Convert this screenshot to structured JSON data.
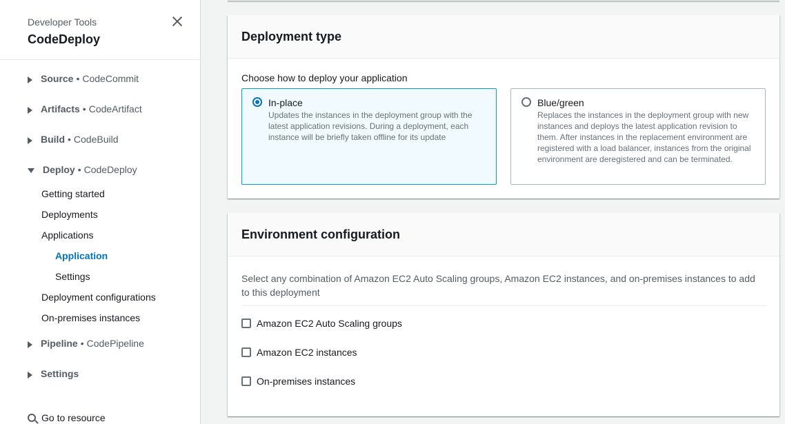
{
  "sidebar": {
    "subtitle": "Developer Tools",
    "title": "CodeDeploy",
    "sections": [
      {
        "name": "Source",
        "service": "CodeCommit"
      },
      {
        "name": "Artifacts",
        "service": "CodeArtifact"
      },
      {
        "name": "Build",
        "service": "CodeBuild"
      },
      {
        "name": "Deploy",
        "service": "CodeDeploy"
      },
      {
        "name": "Pipeline",
        "service": "CodePipeline"
      },
      {
        "name": "Settings",
        "service": ""
      }
    ],
    "deploy_items": {
      "getting_started": "Getting started",
      "deployments": "Deployments",
      "applications": "Applications",
      "application": "Application",
      "settings": "Settings",
      "deployment_configurations": "Deployment configurations",
      "on_premises": "On-premises instances"
    },
    "separator": "•",
    "go_to_resource": "Go to resource"
  },
  "deployment_type": {
    "title": "Deployment type",
    "label": "Choose how to deploy your application",
    "options": [
      {
        "title": "In-place",
        "description": "Updates the instances in the deployment group with the latest application revisions. During a deployment, each instance will be briefly taken offline for its update",
        "selected": true
      },
      {
        "title": "Blue/green",
        "description": "Replaces the instances in the deployment group with new instances and deploys the latest application revision to them. After instances in the replacement environment are registered with a load balancer, instances from the original environment are deregistered and can be terminated.",
        "selected": false
      }
    ]
  },
  "environment": {
    "title": "Environment configuration",
    "description": "Select any combination of Amazon EC2 Auto Scaling groups, Amazon EC2 instances, and on-premises instances to add to this deployment",
    "checkboxes": [
      {
        "label": "Amazon EC2 Auto Scaling groups",
        "checked": false
      },
      {
        "label": "Amazon EC2 instances",
        "checked": false
      },
      {
        "label": "On-premises instances",
        "checked": false
      }
    ]
  },
  "colors": {
    "accent": "#0073bb",
    "selected_border": "#00a1c9",
    "selected_bg": "#f1faff"
  }
}
